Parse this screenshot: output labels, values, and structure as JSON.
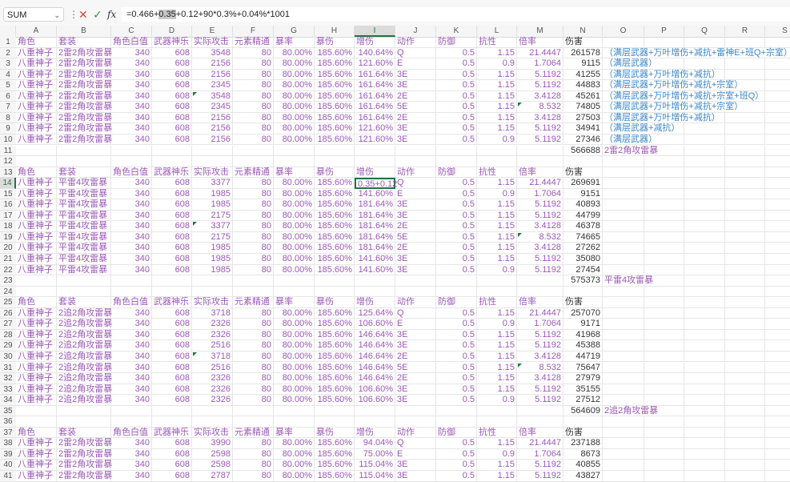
{
  "toolbar": {
    "name_box": "SUM",
    "formula_pre": "=0.466+",
    "formula_sel": "0.35",
    "formula_post": "+0.12+90*0.3%+0.04%*1001",
    "icons": {
      "cancel": "x-icon",
      "enter": "check-icon",
      "function": "fx-icon"
    },
    "fx_label": "fx"
  },
  "colors": {
    "data_text": "#9b59b6",
    "damage_text": "#333333",
    "note_text": "#3a86c8",
    "selection": "#217346"
  },
  "columns": [
    "A",
    "B",
    "C",
    "D",
    "E",
    "F",
    "G",
    "H",
    "I",
    "J",
    "K",
    "L",
    "M",
    "N",
    "O",
    "P",
    "Q",
    "R",
    "S"
  ],
  "selected": {
    "cell": "I14",
    "column": "I",
    "row": 14
  },
  "header_labels": [
    "角色",
    "套装",
    "角色白值",
    "武器神乐",
    "实际攻击",
    "元素精通",
    "暴率",
    "暴伤",
    "增伤",
    "动作",
    "防御",
    "抗性",
    "倍率",
    "伤害"
  ],
  "rows": [
    {
      "r": 1,
      "c": [
        "角色",
        "套装",
        "角色白值",
        "武器神乐",
        "实际攻击",
        "元素精通",
        "暴率",
        "暴伤",
        "增伤",
        "动作",
        "防御",
        "抗性",
        "倍率",
        "伤害"
      ]
    },
    {
      "r": 2,
      "c": [
        "八重神子",
        "2雷2角攻雷暴",
        "340",
        "608",
        "3548",
        "80",
        "80.00%",
        "185.60%",
        "140.64%",
        "Q",
        "0.5",
        "1.15",
        "21.4447",
        "261578",
        "（满层武器+万叶增伤+减抗+雷神E+班Q+宗室）"
      ]
    },
    {
      "r": 3,
      "c": [
        "八重神子",
        "2雷2角攻雷暴",
        "340",
        "608",
        "2156",
        "80",
        "80.00%",
        "185.60%",
        "121.60%",
        "E",
        "0.5",
        "0.9",
        "1.7064",
        "9115",
        "（满层武器）"
      ]
    },
    {
      "r": 4,
      "c": [
        "八重神子",
        "2雷2角攻雷暴",
        "340",
        "608",
        "2156",
        "80",
        "80.00%",
        "185.60%",
        "161.64%",
        "3E",
        "0.5",
        "1.15",
        "5.1192",
        "41255",
        "（满层武器+万叶增伤+减抗）"
      ]
    },
    {
      "r": 5,
      "c": [
        "八重神子",
        "2雷2角攻雷暴",
        "340",
        "608",
        "2345",
        "80",
        "80.00%",
        "185.60%",
        "161.64%",
        "3E",
        "0.5",
        "1.15",
        "5.1192",
        "44883",
        "（满层武器+万叶增伤+减抗+宗室）"
      ]
    },
    {
      "r": 6,
      "c": [
        "八重神子",
        "2雷2角攻雷暴",
        "340",
        "608",
        "3548",
        "80",
        "80.00%",
        "185.60%",
        "161.64%",
        "2E",
        "0.5",
        "1.15",
        "3.4128",
        "45261",
        "（满层武器+万叶增伤+减抗+宗室+班Q）"
      ]
    },
    {
      "r": 7,
      "c": [
        "八重神子",
        "2雷2角攻雷暴",
        "340",
        "608",
        "2345",
        "80",
        "80.00%",
        "185.60%",
        "161.64%",
        "5E",
        "0.5",
        "1.15",
        "8.532",
        "74805",
        "（满层武器+万叶增伤+减抗+宗室）"
      ]
    },
    {
      "r": 8,
      "c": [
        "八重神子",
        "2雷2角攻雷暴",
        "340",
        "608",
        "2156",
        "80",
        "80.00%",
        "185.60%",
        "161.64%",
        "2E",
        "0.5",
        "1.15",
        "3.4128",
        "27503",
        "（满层武器+万叶增伤+减抗）"
      ]
    },
    {
      "r": 9,
      "c": [
        "八重神子",
        "2雷2角攻雷暴",
        "340",
        "608",
        "2156",
        "80",
        "80.00%",
        "185.60%",
        "121.60%",
        "3E",
        "0.5",
        "1.15",
        "5.1192",
        "34941",
        "（满层武器+减抗）"
      ]
    },
    {
      "r": 10,
      "c": [
        "八重神子",
        "2雷2角攻雷暴",
        "340",
        "608",
        "2156",
        "80",
        "80.00%",
        "185.60%",
        "121.60%",
        "3E",
        "0.5",
        "0.9",
        "5.1192",
        "27346",
        "（满层武器）"
      ]
    },
    {
      "r": 11,
      "c": [
        "",
        "",
        "",
        "",
        "",
        "",
        "",
        "",
        "",
        "",
        "",
        "",
        "",
        "566688",
        "2雷2角攻雷暴"
      ]
    },
    {
      "r": 12,
      "c": []
    },
    {
      "r": 13,
      "c": [
        "角色",
        "套装",
        "角色白值",
        "武器神乐",
        "实际攻击",
        "元素精通",
        "暴率",
        "暴伤",
        "增伤",
        "动作",
        "防御",
        "抗性",
        "倍率",
        "伤害"
      ]
    },
    {
      "r": 14,
      "c": [
        "八重神子",
        "平雷4攻雷暴",
        "340",
        "608",
        "3377",
        "80",
        "80.00%",
        "185.60%",
        "0.35+0.12",
        "Q",
        "0.5",
        "1.15",
        "21.4447",
        "269691"
      ]
    },
    {
      "r": 15,
      "c": [
        "八重神子",
        "平雷4攻雷暴",
        "340",
        "608",
        "1985",
        "80",
        "80.00%",
        "185.60%",
        "141.60%",
        "E",
        "0.5",
        "0.9",
        "1.7064",
        "9151"
      ]
    },
    {
      "r": 16,
      "c": [
        "八重神子",
        "平雷4攻雷暴",
        "340",
        "608",
        "1985",
        "80",
        "80.00%",
        "185.60%",
        "181.64%",
        "3E",
        "0.5",
        "1.15",
        "5.1192",
        "40893"
      ]
    },
    {
      "r": 17,
      "c": [
        "八重神子",
        "平雷4攻雷暴",
        "340",
        "608",
        "2175",
        "80",
        "80.00%",
        "185.60%",
        "181.64%",
        "3E",
        "0.5",
        "1.15",
        "5.1192",
        "44799"
      ]
    },
    {
      "r": 18,
      "c": [
        "八重神子",
        "平雷4攻雷暴",
        "340",
        "608",
        "3377",
        "80",
        "80.00%",
        "185.60%",
        "181.64%",
        "2E",
        "0.5",
        "1.15",
        "3.4128",
        "46378"
      ]
    },
    {
      "r": 19,
      "c": [
        "八重神子",
        "平雷4攻雷暴",
        "340",
        "608",
        "2175",
        "80",
        "80.00%",
        "185.60%",
        "181.64%",
        "5E",
        "0.5",
        "1.15",
        "8.532",
        "74665"
      ]
    },
    {
      "r": 20,
      "c": [
        "八重神子",
        "平雷4攻雷暴",
        "340",
        "608",
        "1985",
        "80",
        "80.00%",
        "185.60%",
        "181.64%",
        "2E",
        "0.5",
        "1.15",
        "3.4128",
        "27262"
      ]
    },
    {
      "r": 21,
      "c": [
        "八重神子",
        "平雷4攻雷暴",
        "340",
        "608",
        "1985",
        "80",
        "80.00%",
        "185.60%",
        "141.60%",
        "3E",
        "0.5",
        "1.15",
        "5.1192",
        "35080"
      ]
    },
    {
      "r": 22,
      "c": [
        "八重神子",
        "平雷4攻雷暴",
        "340",
        "608",
        "1985",
        "80",
        "80.00%",
        "185.60%",
        "141.60%",
        "3E",
        "0.5",
        "0.9",
        "5.1192",
        "27454"
      ]
    },
    {
      "r": 23,
      "c": [
        "",
        "",
        "",
        "",
        "",
        "",
        "",
        "",
        "",
        "",
        "",
        "",
        "",
        "575373",
        "平雷4攻雷暴"
      ]
    },
    {
      "r": 24,
      "c": []
    },
    {
      "r": 25,
      "c": [
        "角色",
        "套装",
        "角色白值",
        "武器神乐",
        "实际攻击",
        "元素精通",
        "暴率",
        "暴伤",
        "增伤",
        "动作",
        "防御",
        "抗性",
        "倍率",
        "伤害"
      ]
    },
    {
      "r": 26,
      "c": [
        "八重神子",
        "2追2角攻雷暴",
        "340",
        "608",
        "3718",
        "80",
        "80.00%",
        "185.60%",
        "125.64%",
        "Q",
        "0.5",
        "1.15",
        "21.4447",
        "257070"
      ]
    },
    {
      "r": 27,
      "c": [
        "八重神子",
        "2追2角攻雷暴",
        "340",
        "608",
        "2326",
        "80",
        "80.00%",
        "185.60%",
        "106.60%",
        "E",
        "0.5",
        "0.9",
        "1.7064",
        "9171"
      ]
    },
    {
      "r": 28,
      "c": [
        "八重神子",
        "2追2角攻雷暴",
        "340",
        "608",
        "2326",
        "80",
        "80.00%",
        "185.60%",
        "146.64%",
        "3E",
        "0.5",
        "1.15",
        "5.1192",
        "41968"
      ]
    },
    {
      "r": 29,
      "c": [
        "八重神子",
        "2追2角攻雷暴",
        "340",
        "608",
        "2516",
        "80",
        "80.00%",
        "185.60%",
        "146.64%",
        "3E",
        "0.5",
        "1.15",
        "5.1192",
        "45388"
      ]
    },
    {
      "r": 30,
      "c": [
        "八重神子",
        "2追2角攻雷暴",
        "340",
        "608",
        "3718",
        "80",
        "80.00%",
        "185.60%",
        "146.64%",
        "2E",
        "0.5",
        "1.15",
        "3.4128",
        "44719"
      ]
    },
    {
      "r": 31,
      "c": [
        "八重神子",
        "2追2角攻雷暴",
        "340",
        "608",
        "2516",
        "80",
        "80.00%",
        "185.60%",
        "146.64%",
        "5E",
        "0.5",
        "1.15",
        "8.532",
        "75647"
      ]
    },
    {
      "r": 32,
      "c": [
        "八重神子",
        "2追2角攻雷暴",
        "340",
        "608",
        "2326",
        "80",
        "80.00%",
        "185.60%",
        "146.64%",
        "2E",
        "0.5",
        "1.15",
        "3.4128",
        "27979"
      ]
    },
    {
      "r": 33,
      "c": [
        "八重神子",
        "2追2角攻雷暴",
        "340",
        "608",
        "2326",
        "80",
        "80.00%",
        "185.60%",
        "106.60%",
        "3E",
        "0.5",
        "1.15",
        "5.1192",
        "35155"
      ]
    },
    {
      "r": 34,
      "c": [
        "八重神子",
        "2追2角攻雷暴",
        "340",
        "608",
        "2326",
        "80",
        "80.00%",
        "185.60%",
        "106.60%",
        "3E",
        "0.5",
        "0.9",
        "5.1192",
        "27512"
      ]
    },
    {
      "r": 35,
      "c": [
        "",
        "",
        "",
        "",
        "",
        "",
        "",
        "",
        "",
        "",
        "",
        "",
        "",
        "564609",
        "2追2角攻雷暴"
      ]
    },
    {
      "r": 36,
      "c": []
    },
    {
      "r": 37,
      "c": [
        "角色",
        "套装",
        "角色白值",
        "武器神乐",
        "实际攻击",
        "元素精通",
        "暴率",
        "暴伤",
        "增伤",
        "动作",
        "防御",
        "抗性",
        "倍率",
        "伤害"
      ]
    },
    {
      "r": 38,
      "c": [
        "八重神子",
        "2雷2角攻雷暴",
        "340",
        "608",
        "3990",
        "80",
        "80.00%",
        "185.60%",
        "94.04%",
        "Q",
        "0.5",
        "1.15",
        "21.4447",
        "237188"
      ]
    },
    {
      "r": 39,
      "c": [
        "八重神子",
        "2雷2角攻雷暴",
        "340",
        "608",
        "2598",
        "80",
        "80.00%",
        "185.60%",
        "75.00%",
        "E",
        "0.5",
        "0.9",
        "1.7064",
        "8673"
      ]
    },
    {
      "r": 40,
      "c": [
        "八重神子",
        "2雷2角攻雷暴",
        "340",
        "608",
        "2598",
        "80",
        "80.00%",
        "185.60%",
        "115.04%",
        "3E",
        "0.5",
        "1.15",
        "5.1192",
        "40855"
      ]
    },
    {
      "r": 41,
      "c": [
        "八重神子",
        "2雷2角攻雷暴",
        "340",
        "608",
        "2787",
        "80",
        "80.00%",
        "185.60%",
        "115.04%",
        "3E",
        "0.5",
        "1.15",
        "5.1192",
        "43827"
      ]
    }
  ]
}
